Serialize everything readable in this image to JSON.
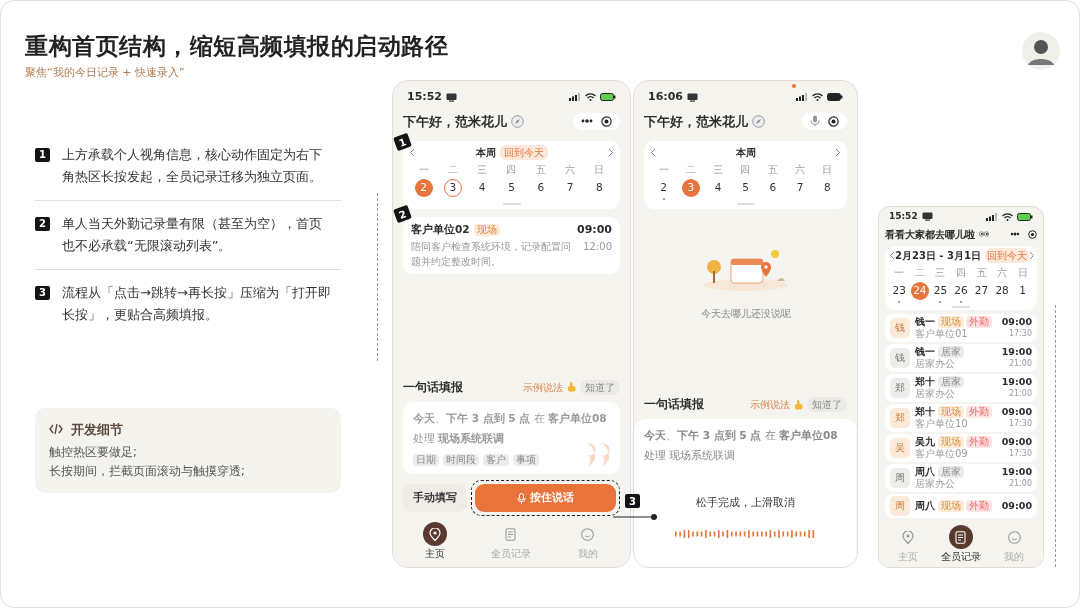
{
  "title": "重构首页结构，缩短高频填报的启动路径",
  "subtitle": "聚焦“我的今日记录 + 快速录入”",
  "points": [
    {
      "marker": "1",
      "text": "上方承载个人视角信息，核心动作固定为右下角热区长按发起，全员记录迁移为独立页面。"
    },
    {
      "marker": "2",
      "text": "单人当天外勤记录量有限（甚至为空），首页也不必承载“无限滚动列表”。"
    },
    {
      "marker": "3",
      "text": "流程从「点击→跳转→再长按」压缩为「打开即长按」，更贴合高频填报。"
    }
  ],
  "dev_note": {
    "title": "开发细节",
    "lines": [
      "触控热区要做足;",
      "长按期间，拦截页面滚动与触摸穿透;"
    ]
  },
  "phone_home": {
    "time": "15:52",
    "greeting": "下午好，范米花儿",
    "calendar": {
      "marker": "1",
      "title": "本周",
      "today_chip": "回到今天",
      "weekdays": [
        "一",
        "二",
        "三",
        "四",
        "五",
        "六",
        "日"
      ],
      "days": [
        {
          "label": "2",
          "selected": true,
          "today": false,
          "dot": false
        },
        {
          "label": "3",
          "selected": false,
          "today": true,
          "dot": false
        },
        {
          "label": "4",
          "selected": false,
          "today": false,
          "dot": false
        },
        {
          "label": "5",
          "selected": false,
          "today": false,
          "dot": false
        },
        {
          "label": "6",
          "selected": false,
          "today": false,
          "dot": false
        },
        {
          "label": "7",
          "selected": false,
          "today": false,
          "dot": false
        },
        {
          "label": "8",
          "selected": false,
          "today": false,
          "dot": false
        }
      ]
    },
    "record": {
      "marker": "2",
      "title": "客户单位02",
      "tag": "现场",
      "desc": "陪同客户检查系统环境，记录配置问题并约定整改时间。",
      "start": "09:00",
      "end": "12:00"
    },
    "quick": {
      "title": "一句话填报",
      "example": "示例说法",
      "ack": "知道了",
      "sentence": "**今天**、**下午 3 点到 5 点** 在 **客户单位08** 处理 **现场系统联调**",
      "tags": [
        "日期",
        "时间段",
        "客户",
        "事项"
      ],
      "manual": "手动填写",
      "hold": "按住说话",
      "marker": "3"
    },
    "nav": [
      {
        "label": "主页",
        "selected": true
      },
      {
        "label": "全员记录",
        "selected": false
      },
      {
        "label": "我的",
        "selected": false
      }
    ]
  },
  "phone_recording": {
    "time": "16:06",
    "greeting": "下午好，范米花儿",
    "calendar": {
      "title": "本周",
      "weekdays": [
        "一",
        "二",
        "三",
        "四",
        "五",
        "六",
        "日"
      ],
      "days": [
        {
          "label": "2",
          "selected": false,
          "today": false,
          "dot": true
        },
        {
          "label": "3",
          "selected": true,
          "today": false,
          "dot": false
        },
        {
          "label": "4",
          "selected": false,
          "today": false,
          "dot": false
        },
        {
          "label": "5",
          "selected": false,
          "today": false,
          "dot": false
        },
        {
          "label": "6",
          "selected": false,
          "today": false,
          "dot": false
        },
        {
          "label": "7",
          "selected": false,
          "today": false,
          "dot": false
        },
        {
          "label": "8",
          "selected": false,
          "today": false,
          "dot": false
        }
      ]
    },
    "empty_text": "今天去哪儿还没说呢",
    "quick": {
      "title": "一句话填报",
      "example": "示例说法",
      "ack": "知道了",
      "sentence": "**今天**、**下午 3 点到 5 点** 在 **客户单位08** 处理 现场系统联调",
      "release_hint": "松手完成，上滑取消"
    }
  },
  "phone_team": {
    "time": "15:52",
    "title": "看看大家都去哪儿啦",
    "calendar": {
      "title": "2月23日 - 3月1日",
      "today_chip": "回到今天",
      "weekdays": [
        "一",
        "二",
        "三",
        "四",
        "五",
        "六",
        "日"
      ],
      "days": [
        {
          "label": "23",
          "selected": false,
          "today": false,
          "dot": true
        },
        {
          "label": "24",
          "selected": true,
          "today": false,
          "dot": false
        },
        {
          "label": "25",
          "selected": false,
          "today": false,
          "dot": true
        },
        {
          "label": "26",
          "selected": false,
          "today": false,
          "dot": true
        },
        {
          "label": "27",
          "selected": false,
          "today": false,
          "dot": false
        },
        {
          "label": "28",
          "selected": false,
          "today": false,
          "dot": false
        },
        {
          "label": "1",
          "selected": false,
          "today": false,
          "dot": false
        }
      ]
    },
    "rows": [
      {
        "avatar": "钱",
        "kind": "field",
        "name": "钱一",
        "tags": [
          {
            "label": "现场",
            "kind": "field"
          },
          {
            "label": "外勤",
            "kind": "out"
          }
        ],
        "place": "客户单位01",
        "start": "09:00",
        "end": "17:30"
      },
      {
        "avatar": "钱",
        "kind": "home",
        "name": "钱一",
        "tags": [
          {
            "label": "居家",
            "kind": "home"
          }
        ],
        "place": "居家办公",
        "start": "19:00",
        "end": "21:00"
      },
      {
        "avatar": "郑",
        "kind": "home",
        "name": "郑十",
        "tags": [
          {
            "label": "居家",
            "kind": "home"
          }
        ],
        "place": "居家办公",
        "start": "19:00",
        "end": "21:00"
      },
      {
        "avatar": "郑",
        "kind": "field",
        "name": "郑十",
        "tags": [
          {
            "label": "现场",
            "kind": "field"
          },
          {
            "label": "外勤",
            "kind": "out"
          }
        ],
        "place": "客户单位10",
        "start": "09:00",
        "end": "17:30"
      },
      {
        "avatar": "吴",
        "kind": "field",
        "name": "吴九",
        "tags": [
          {
            "label": "现场",
            "kind": "field"
          },
          {
            "label": "外勤",
            "kind": "out"
          }
        ],
        "place": "客户单位09",
        "start": "09:00",
        "end": "17:30"
      },
      {
        "avatar": "周",
        "kind": "home",
        "name": "周八",
        "tags": [
          {
            "label": "居家",
            "kind": "home"
          }
        ],
        "place": "居家办公",
        "start": "19:00",
        "end": "21:00"
      },
      {
        "avatar": "周",
        "kind": "field",
        "name": "周八",
        "tags": [
          {
            "label": "现场",
            "kind": "field"
          },
          {
            "label": "外勤",
            "kind": "out"
          }
        ],
        "start": "09:00"
      }
    ],
    "nav": [
      {
        "label": "主页",
        "selected": false
      },
      {
        "label": "全员记录",
        "selected": true
      },
      {
        "label": "我的",
        "selected": false
      }
    ]
  }
}
